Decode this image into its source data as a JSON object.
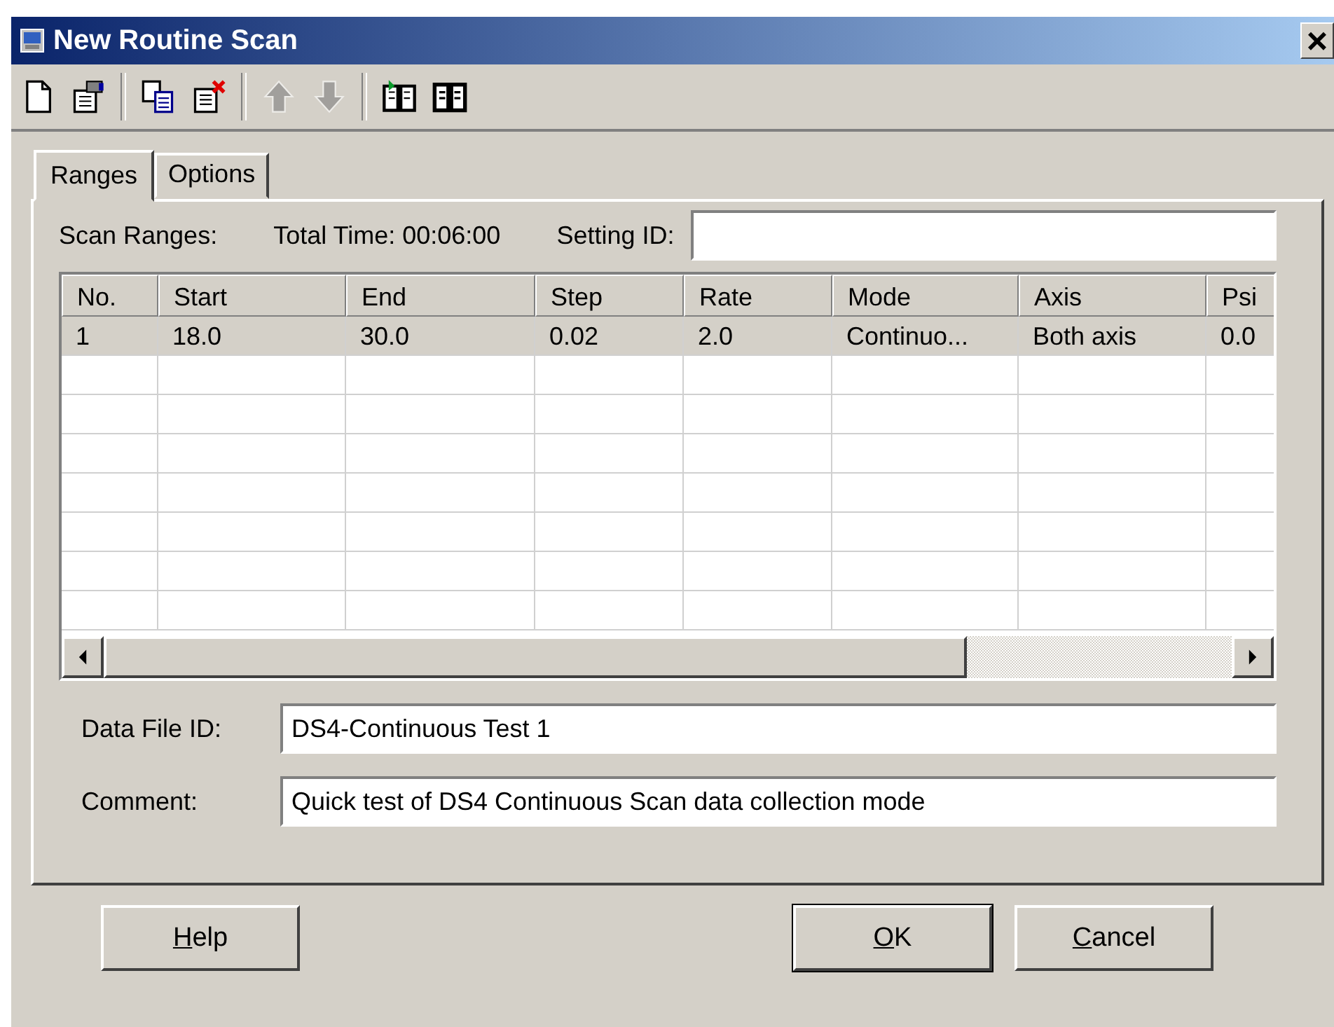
{
  "window": {
    "title": "New Routine Scan",
    "close": "×"
  },
  "toolbar": [
    [
      {
        "kind": "new",
        "disabled": false
      },
      {
        "kind": "properties",
        "disabled": false
      }
    ],
    [
      {
        "kind": "copy",
        "disabled": false
      },
      {
        "kind": "delete",
        "disabled": false
      }
    ],
    [
      {
        "kind": "up",
        "disabled": true
      },
      {
        "kind": "down",
        "disabled": true
      }
    ],
    [
      {
        "kind": "book-import",
        "disabled": false
      },
      {
        "kind": "book",
        "disabled": false
      }
    ]
  ],
  "tabs": [
    {
      "label": "Ranges",
      "selected": true
    },
    {
      "label": "Options",
      "selected": false
    }
  ],
  "scan_ranges_label": "Scan Ranges:",
  "total_time": "Total Time: 00:06:00",
  "setting_id": {
    "label": "Setting ID:"
  },
  "table": {
    "columns": [
      "No.",
      "Start",
      "End",
      "Step",
      "Rate",
      "Mode",
      "Axis",
      "Psi"
    ],
    "rows": [
      {
        "cells": [
          "1",
          "18.0",
          "30.0",
          "0.02",
          "2.0",
          "Continuo...",
          "Both axis",
          "0.0"
        ],
        "selected": true
      }
    ]
  },
  "data_file_id": {
    "label": "Data File ID:",
    "value": "DS4-Continuous Test 1"
  },
  "comment": {
    "label": "Comment:",
    "value": "Quick test of DS4 Continuous Scan data collection mode"
  },
  "buttons": [
    {
      "label": "Help",
      "default": false
    },
    {
      "label": "OK",
      "default": true
    },
    {
      "label": "Cancel",
      "default": false
    }
  ]
}
